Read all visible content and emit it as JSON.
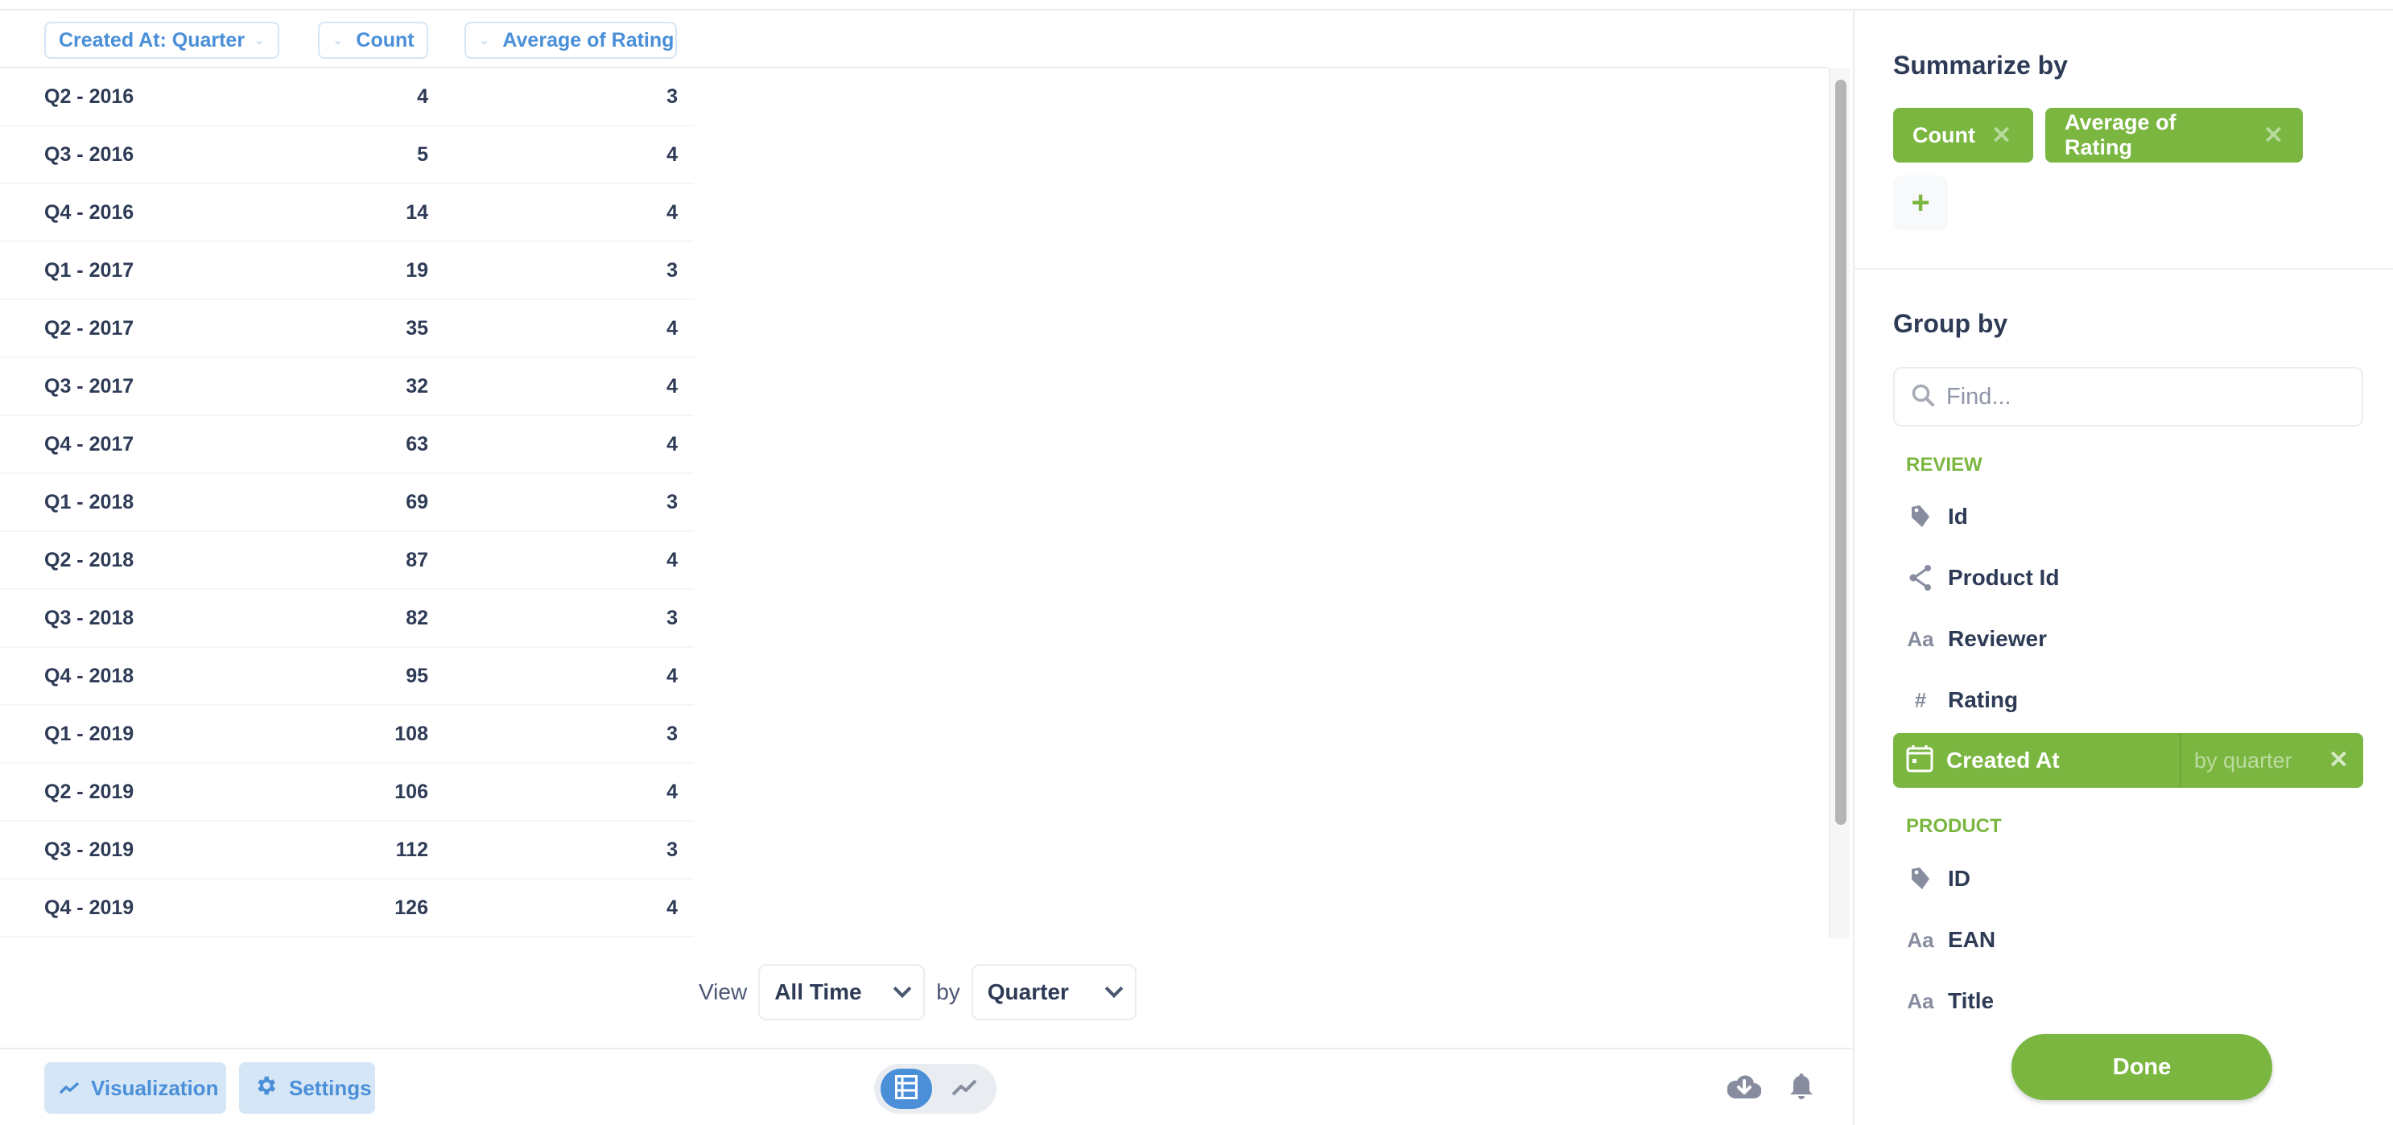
{
  "table": {
    "columns": [
      {
        "label": "Created At: Quarter"
      },
      {
        "label": "Count"
      },
      {
        "label": "Average of Rating"
      }
    ],
    "rows": [
      {
        "quarter": "Q2 - 2016",
        "count": "4",
        "avg_rating": "3"
      },
      {
        "quarter": "Q3 - 2016",
        "count": "5",
        "avg_rating": "4"
      },
      {
        "quarter": "Q4 - 2016",
        "count": "14",
        "avg_rating": "4"
      },
      {
        "quarter": "Q1 - 2017",
        "count": "19",
        "avg_rating": "3"
      },
      {
        "quarter": "Q2 - 2017",
        "count": "35",
        "avg_rating": "4"
      },
      {
        "quarter": "Q3 - 2017",
        "count": "32",
        "avg_rating": "4"
      },
      {
        "quarter": "Q4 - 2017",
        "count": "63",
        "avg_rating": "4"
      },
      {
        "quarter": "Q1 - 2018",
        "count": "69",
        "avg_rating": "3"
      },
      {
        "quarter": "Q2 - 2018",
        "count": "87",
        "avg_rating": "4"
      },
      {
        "quarter": "Q3 - 2018",
        "count": "82",
        "avg_rating": "3"
      },
      {
        "quarter": "Q4 - 2018",
        "count": "95",
        "avg_rating": "4"
      },
      {
        "quarter": "Q1 - 2019",
        "count": "108",
        "avg_rating": "3"
      },
      {
        "quarter": "Q2 - 2019",
        "count": "106",
        "avg_rating": "4"
      },
      {
        "quarter": "Q3 - 2019",
        "count": "112",
        "avg_rating": "3"
      },
      {
        "quarter": "Q4 - 2019",
        "count": "126",
        "avg_rating": "4"
      }
    ]
  },
  "view_controls": {
    "view_label": "View",
    "period_value": "All Time",
    "by_label": "by",
    "granularity_value": "Quarter"
  },
  "bottom_bar": {
    "visualization_label": "Visualization",
    "settings_label": "Settings",
    "display_mode": "table",
    "icons": [
      "download-icon",
      "bell-icon"
    ]
  },
  "sidebar": {
    "summarize_title": "Summarize by",
    "aggregations": [
      {
        "label": "Count"
      },
      {
        "label": "Average of Rating"
      }
    ],
    "add_label": "+",
    "group_title": "Group by",
    "find_placeholder": "Find...",
    "find_value": "",
    "sections": [
      {
        "label": "REVIEW",
        "fields": [
          {
            "label": "Id",
            "icon": "tag-icon"
          },
          {
            "label": "Product Id",
            "icon": "share-icon"
          },
          {
            "label": "Reviewer",
            "icon": "text-icon"
          },
          {
            "label": "Rating",
            "icon": "number-icon"
          },
          {
            "label": "Created At",
            "icon": "calendar-icon",
            "selected": true,
            "binning": "by quarter"
          }
        ]
      },
      {
        "label": "PRODUCT",
        "fields": [
          {
            "label": "ID",
            "icon": "tag-icon"
          },
          {
            "label": "EAN",
            "icon": "text-icon"
          },
          {
            "label": "Title",
            "icon": "text-icon"
          }
        ]
      }
    ],
    "done_label": "Done"
  },
  "colors": {
    "accent_green": "#7ab640",
    "accent_blue": "#4a8fd8",
    "text_dark": "#2e3b56",
    "icon_gray": "#878d9f"
  }
}
